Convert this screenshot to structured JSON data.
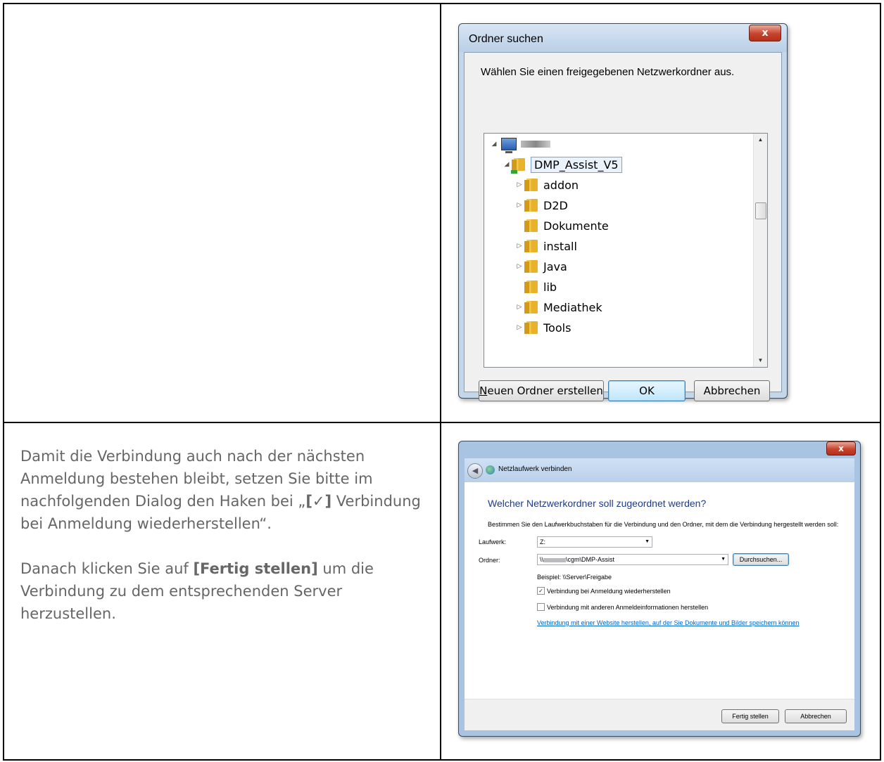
{
  "instructions": {
    "para1_a": "Damit die Verbindung auch nach der nächsten Anmeldung bestehen bleibt, setzen Sie bitte im nachfolgenden Dialog den Haken bei „",
    "para1_bold": "[✓]",
    "para1_b": " Verbindung bei Anmeldung wiederherstellen“.",
    "para2_a": "Danach klicken Sie auf ",
    "para2_bold": "[Fertig stellen]",
    "para2_b": " um die Verbindung zu dem entsprechenden Server herzustellen."
  },
  "folder_dialog": {
    "title": "Ordner suchen",
    "close_glyph": "x",
    "prompt": "Wählen Sie einen freigegebenen Netzwerkordner aus.",
    "root_selected": "DMP_Assist_V5",
    "folders": [
      {
        "label": "addon",
        "expandable": true
      },
      {
        "label": "D2D",
        "expandable": true
      },
      {
        "label": "Dokumente",
        "expandable": false
      },
      {
        "label": "install",
        "expandable": true
      },
      {
        "label": "Java",
        "expandable": true
      },
      {
        "label": "lib",
        "expandable": false
      },
      {
        "label": "Mediathek",
        "expandable": true
      },
      {
        "label": "Tools",
        "expandable": true
      }
    ],
    "new_folder_mnemonic": "N",
    "new_folder_rest": "euen Ordner erstellen",
    "ok_label": "OK",
    "cancel_label": "Abbrechen"
  },
  "map_drive_dialog": {
    "close_glyph": "x",
    "header_title": "Netzlaufwerk verbinden",
    "heading": "Welcher Netzwerkordner soll zugeordnet werden?",
    "description": "Bestimmen Sie den Laufwerkbuchstaben für die Verbindung und den Ordner, mit dem die Verbindung hergestellt werden soll:",
    "drive_label": "Laufwerk:",
    "drive_value": "Z:",
    "folder_label": "Ordner:",
    "folder_value_prefix": "\\\\",
    "folder_value_suffix": "\\cgm\\DMP-Assist",
    "browse_label": "Durchsuchen...",
    "example": "Beispiel: \\\\Server\\Freigabe",
    "reconnect_label": "Verbindung bei Anmeldung wiederherstellen",
    "reconnect_checked": true,
    "other_creds_label": "Verbindung mit anderen Anmeldeinformationen herstellen",
    "other_creds_checked": false,
    "website_link": "Verbindung mit einer Website herstellen, auf der Sie Dokumente und Bilder speichern können",
    "finish_label": "Fertig stellen",
    "cancel_label": "Abbrechen"
  }
}
